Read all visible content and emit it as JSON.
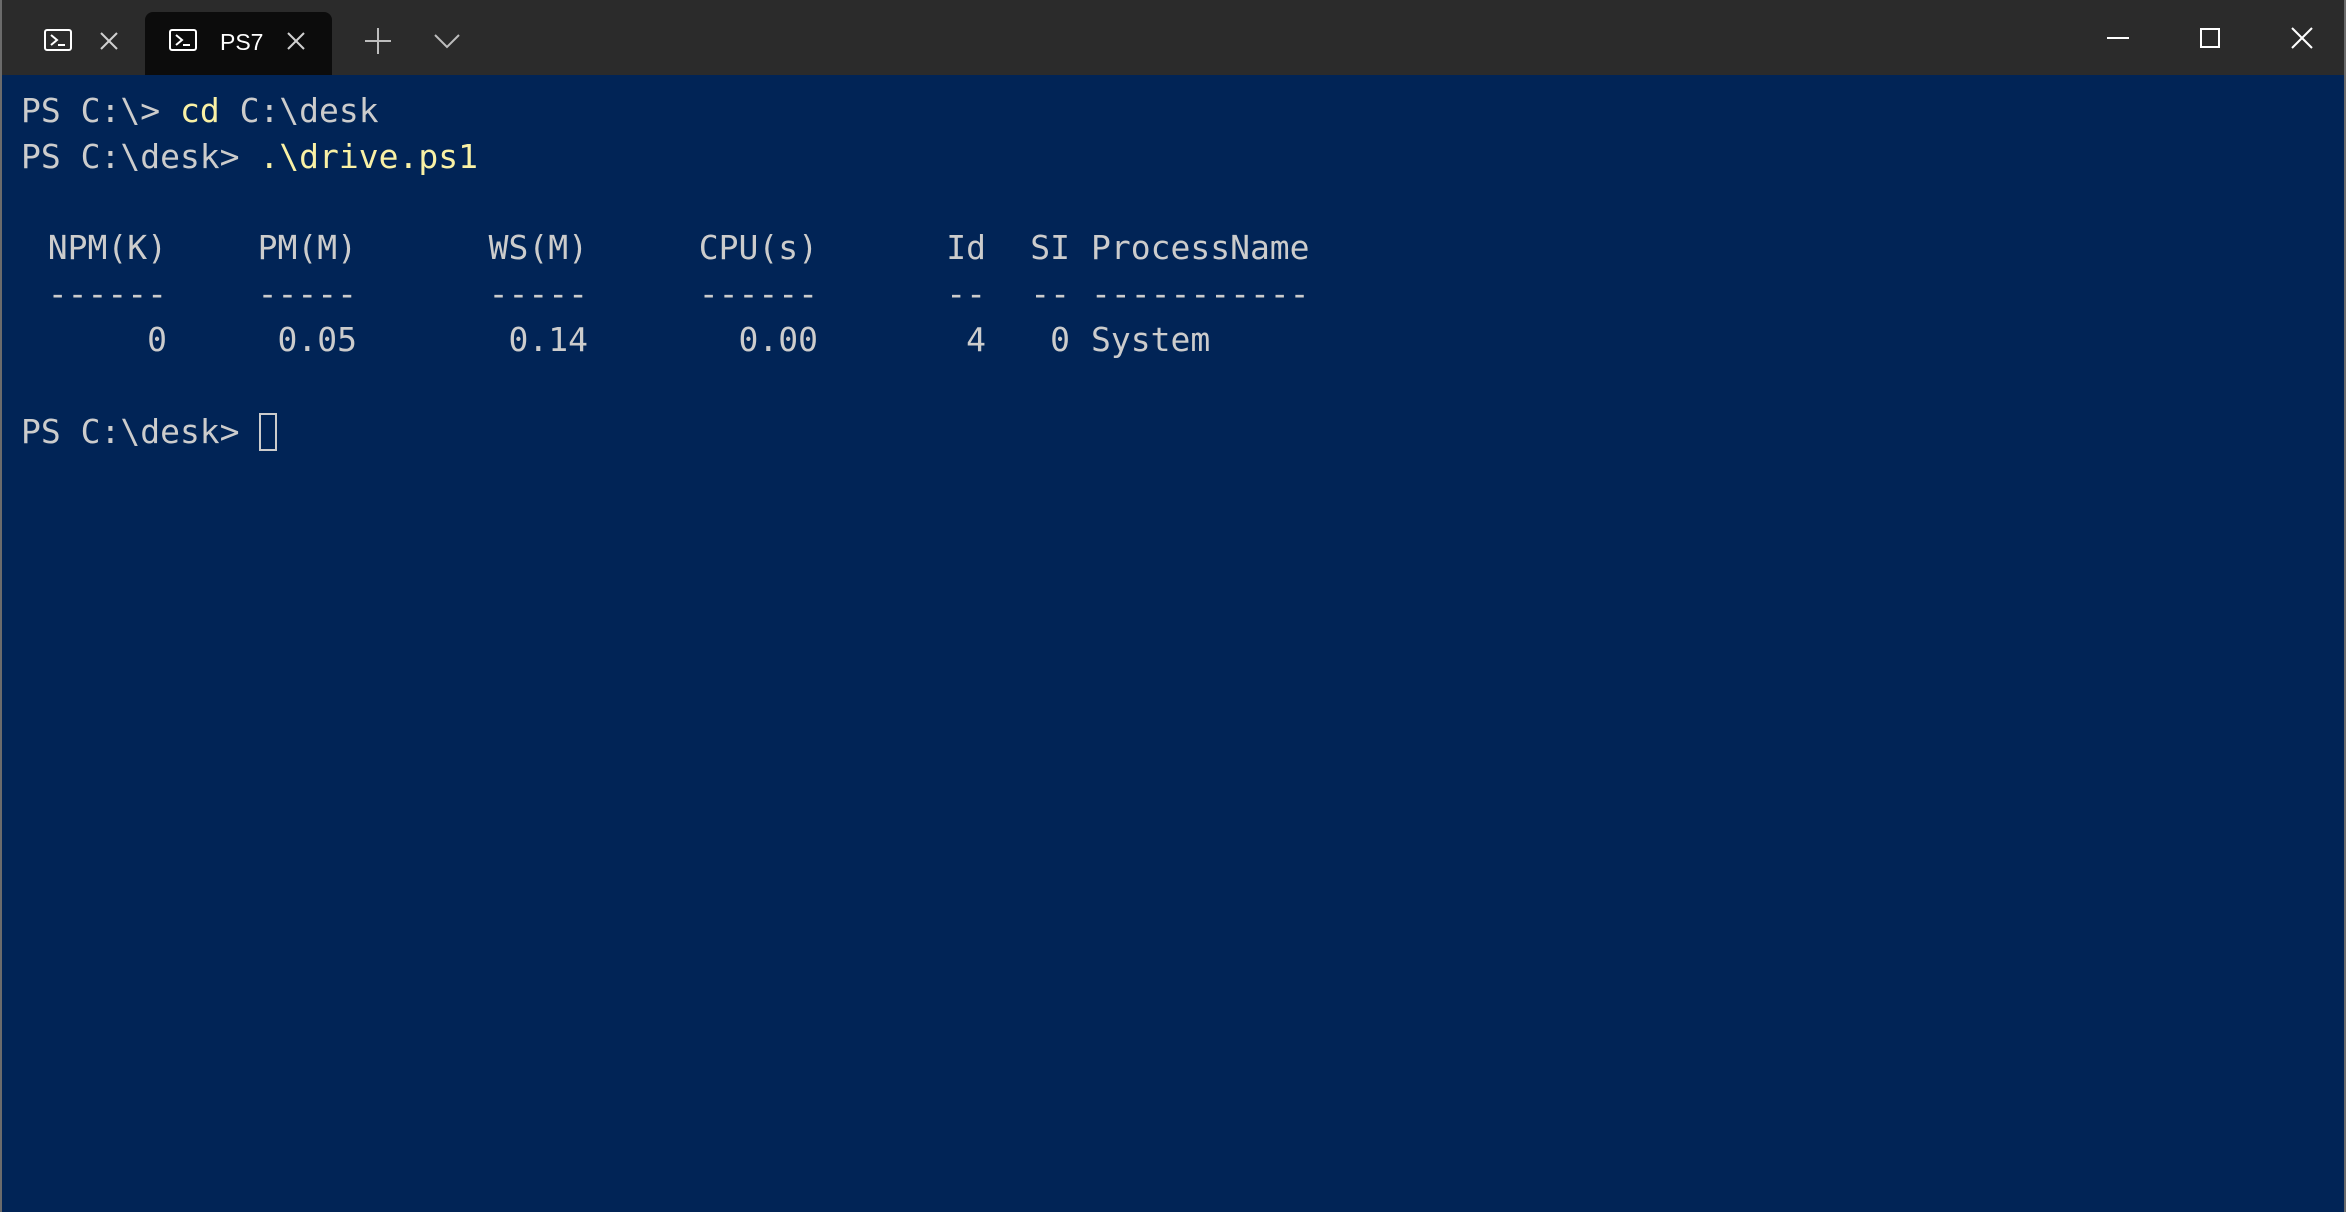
{
  "tabs": [
    {
      "title": "",
      "icon": "powershell-icon",
      "active": false
    },
    {
      "title": "PS7",
      "icon": "powershell-icon",
      "active": true
    }
  ],
  "titlebar": {
    "new_tab_icon": "plus-icon",
    "dropdown_icon": "chevron-down-icon",
    "minimize_icon": "minimize-icon",
    "maximize_icon": "maximize-icon",
    "close_icon": "close-icon"
  },
  "terminal": {
    "background": "#012456",
    "foreground": "#cccccc",
    "command_color": "#f9f1a5",
    "lines": [
      {
        "prompt": "PS C:\\> ",
        "command": "cd",
        "args": " C:\\desk"
      },
      {
        "prompt": "PS C:\\desk> ",
        "command": ".\\drive.ps1",
        "args": ""
      }
    ],
    "table": {
      "headers": [
        "NPM(K)",
        "PM(M)",
        "WS(M)",
        "CPU(s)",
        "Id",
        "SI",
        "ProcessName"
      ],
      "separators": [
        "------",
        "-----",
        "-----",
        "------",
        "--",
        "--",
        "-----------"
      ],
      "rows": [
        [
          "0",
          "0.05",
          "0.14",
          "0.00",
          "4",
          "0",
          "System"
        ]
      ]
    },
    "final_prompt": "PS C:\\desk> "
  }
}
